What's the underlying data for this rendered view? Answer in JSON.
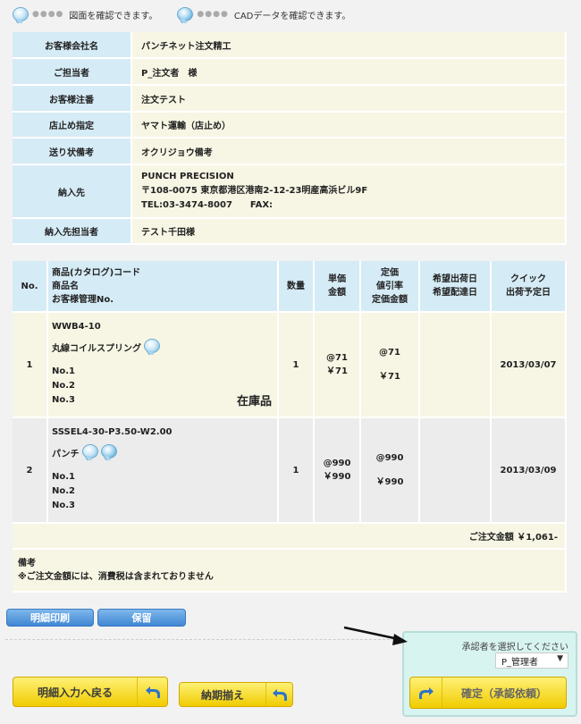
{
  "legend": {
    "drawing": "図面を確認できます。",
    "cad": "CADデータを確認できます。"
  },
  "info": [
    {
      "label": "お客様会社名",
      "value": "パンチネット注文精工"
    },
    {
      "label": "ご担当者",
      "value": "P_注文者　様"
    },
    {
      "label": "お客様注番",
      "value": "注文テスト"
    },
    {
      "label": "店止め指定",
      "value": "ヤマト運輸（店止め）"
    },
    {
      "label": "送り状備考",
      "value": "オクリジョウ備考"
    },
    {
      "label": "納入先",
      "lines": [
        "PUNCH PRECISION",
        "〒108-0075 東京都港区港南2-12-23明産高浜ビル9F",
        "TEL:03-3474-8007　　FAX:"
      ]
    },
    {
      "label": "納入先担当者",
      "value": "テスト千田様"
    }
  ],
  "order": {
    "headers": {
      "no": "No.",
      "product": [
        "商品(カタログ)コード",
        "商品名",
        "お客様管理No."
      ],
      "qty": "数量",
      "price": [
        "単価",
        "金額"
      ],
      "list": [
        "定価",
        "値引率",
        "定価金額"
      ],
      "dates": [
        "希望出荷日",
        "希望配達日"
      ],
      "quick": [
        "クイック",
        "出荷予定日"
      ]
    },
    "rows": [
      {
        "no": "1",
        "code": "WWB4-10",
        "name": "丸線コイルスプリング",
        "mgmt": [
          "No.1",
          "No.2",
          "No.3"
        ],
        "stock": "在庫品",
        "qty": "1",
        "unit": "@71",
        "amount": "￥71",
        "list_unit": "@71",
        "list_amount": "￥71",
        "date": "2013/03/07"
      },
      {
        "no": "2",
        "code": "SSSEL4-30-P3.50-W2.00",
        "name": "パンチ",
        "mgmt": [
          "No.1",
          "No.2",
          "No.3"
        ],
        "stock": "",
        "qty": "1",
        "unit": "@990",
        "amount": "￥990",
        "list_unit": "@990",
        "list_amount": "￥990",
        "date": "2013/03/09"
      }
    ],
    "total": "ご注文金額 ￥1,061-",
    "note_label": "備考",
    "note_text": "※ご注文金額には、消費税は含まれておりません"
  },
  "buttons": {
    "print": "明細印刷",
    "hold": "保留",
    "back": "明細入力へ戻る",
    "deadline": "納期揃え",
    "confirm": "確定（承認依頼）"
  },
  "approver": {
    "prompt": "承認者を選択してください",
    "selected": "P_管理者"
  },
  "colors": {
    "label_bg": "#d5ebf6",
    "value_bg": "#f7f6e4",
    "button_yellow": "#f0cc00",
    "button_blue": "#3f86d3",
    "panel_bg": "#d8f4f0"
  }
}
